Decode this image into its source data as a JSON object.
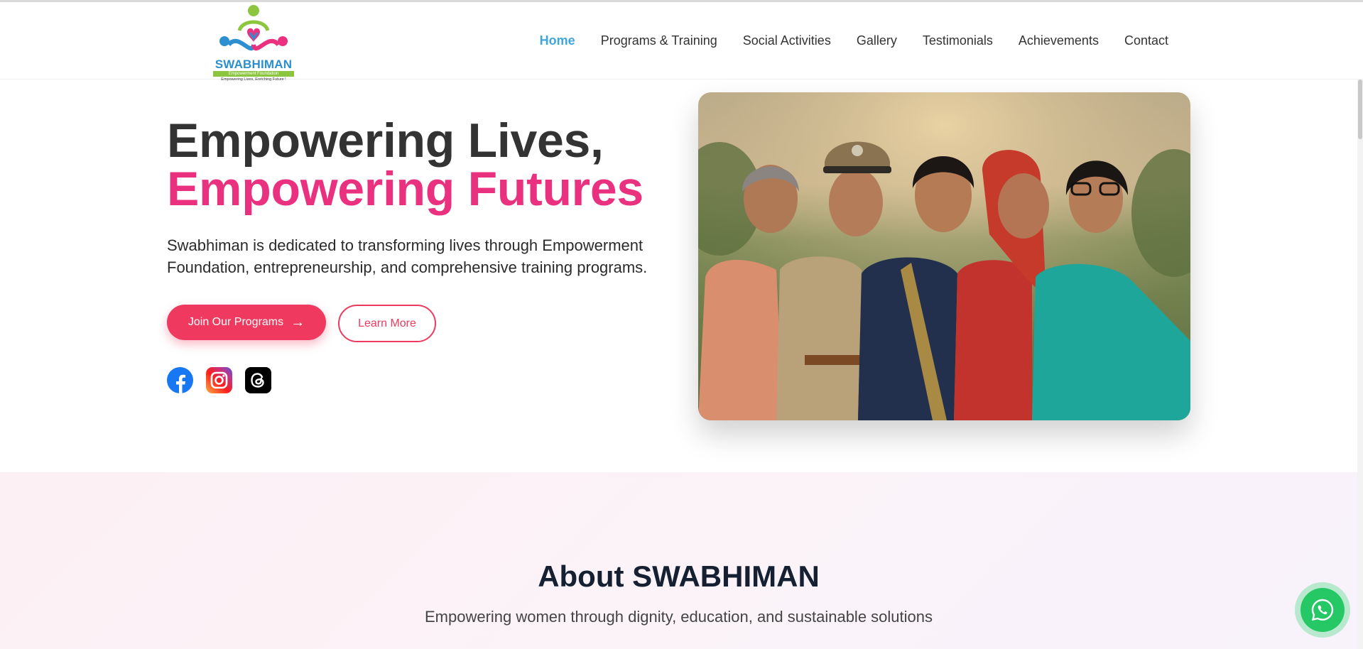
{
  "brand": {
    "name": "SWABHIMAN",
    "subtitle": "Empowerment Foundation",
    "tagline": "Empowering Lives, Enriching Future !",
    "colors": {
      "blue": "#2c8fd0",
      "green": "#8cc63f",
      "pink": "#e9317f"
    }
  },
  "nav": {
    "items": [
      {
        "label": "Home",
        "active": true
      },
      {
        "label": "Programs & Training",
        "active": false
      },
      {
        "label": "Social Activities",
        "active": false
      },
      {
        "label": "Gallery",
        "active": false
      },
      {
        "label": "Testimonials",
        "active": false
      },
      {
        "label": "Achievements",
        "active": false
      },
      {
        "label": "Contact",
        "active": false
      }
    ]
  },
  "hero": {
    "title_line1": "Empowering Lives,",
    "title_line2": "Empowering Futures",
    "description": "Swabhiman is dedicated to transforming lives through Empowerment Foundation, entrepreneurship, and comprehensive training programs.",
    "primary_button": "Join Our Programs",
    "secondary_button": "Learn More",
    "accent_color": "#f0395f",
    "socials": [
      "facebook-icon",
      "instagram-icon",
      "threads-icon"
    ]
  },
  "about": {
    "title": "About SWABHIMAN",
    "subtitle": "Empowering women through dignity, education, and sustainable solutions"
  },
  "floating": {
    "icon": "whatsapp-icon",
    "color": "#25c865"
  }
}
